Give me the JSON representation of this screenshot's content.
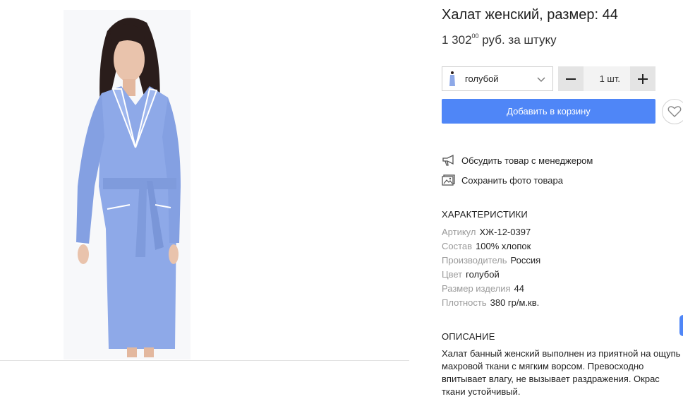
{
  "product": {
    "title": "Халат женский, размер: 44",
    "price_main": "1 302",
    "price_cents": "00",
    "price_unit": " руб. за штуку"
  },
  "purchase": {
    "color_selected": "голубой",
    "color_swatch": "#8ea9e8",
    "quantity": "1 шт.",
    "add_to_cart_label": "Добавить в корзину",
    "accent_color": "#4f86f7"
  },
  "actions": [
    {
      "label": "Обсудить товар с менеджером",
      "icon": "megaphone-icon"
    },
    {
      "label": "Сохранить фото товара",
      "icon": "image-icon"
    }
  ],
  "specs": {
    "heading": "ХАРАКТЕРИСТИКИ",
    "rows": [
      {
        "key": "Артикул",
        "value": "ХЖ-12-0397"
      },
      {
        "key": "Состав",
        "value": "100% хлопок"
      },
      {
        "key": "Производитель",
        "value": "Россия"
      },
      {
        "key": "Цвет",
        "value": "голубой"
      },
      {
        "key": "Размер изделия",
        "value": "44"
      },
      {
        "key": "Плотность",
        "value": "380 гр/м.кв."
      }
    ]
  },
  "description": {
    "heading": "ОПИСАНИЕ",
    "text": "Халат банный женский выполнен из приятной на ощупь махровой ткани с мягким ворсом. Превосходно впитывает влагу, не вызывает раздражения. Окрас ткани устойчивый."
  }
}
